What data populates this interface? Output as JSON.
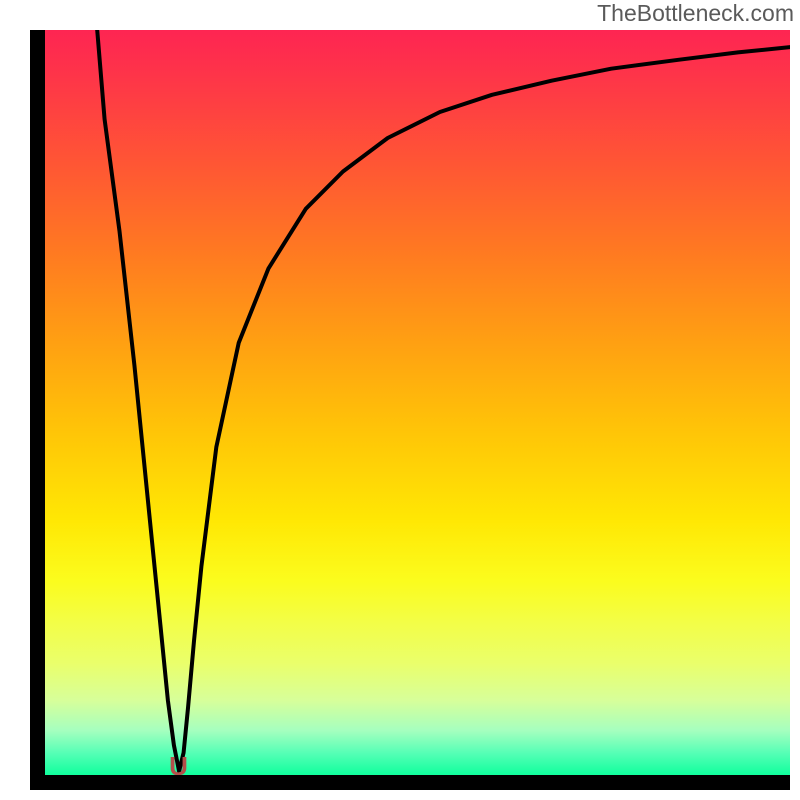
{
  "watermark": "TheBottleneck.com",
  "chart_data": {
    "type": "line",
    "title": "",
    "xlabel": "",
    "ylabel": "",
    "xlim": [
      0,
      100
    ],
    "ylim": [
      0,
      100
    ],
    "series": [
      {
        "name": "bottleneck-curve",
        "x": [
          7,
          8,
          10,
          12,
          14,
          15.5,
          16.5,
          17.3,
          18,
          18.6,
          19.2,
          20,
          21,
          23,
          26,
          30,
          35,
          40,
          46,
          53,
          60,
          68,
          76,
          85,
          93,
          100
        ],
        "y": [
          100,
          88,
          73,
          55,
          35,
          20,
          10,
          4,
          0.5,
          3,
          9,
          18,
          28,
          44,
          58,
          68,
          76,
          81,
          85.5,
          89,
          91.3,
          93.2,
          94.8,
          96,
          97,
          97.7
        ]
      }
    ],
    "minimum_marker": {
      "x": 18,
      "y": 0,
      "symbol": "U"
    },
    "gradient_stops": [
      {
        "pos": 0,
        "color": "#fe2552"
      },
      {
        "pos": 100,
        "color": "#10ff9d"
      }
    ]
  }
}
